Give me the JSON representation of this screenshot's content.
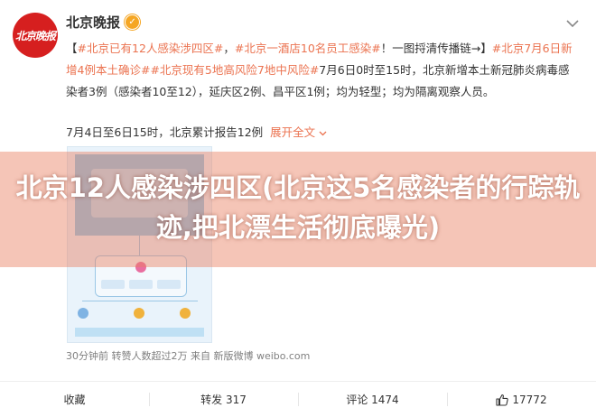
{
  "header": {
    "avatar_text": "北京晚报",
    "user_name": "北京晚报",
    "verified_icon": "verified-badge-icon"
  },
  "post": {
    "bracket_open": "【",
    "tag1": "#北京已有12人感染涉四区#",
    "sep1": "，",
    "tag2": "#北京一酒店10名员工感染#",
    "mid1": "！一图捋清传播链→】",
    "tag3": "#北京7月6日新增4例本土确诊#",
    "tag4": "#北京现有5地高风险7地中风险#",
    "body": "7月6日0时至15时，北京新增本土新冠肺炎病毒感染者3例（感染者10至12），延庆区2例、昌平区1例；均为轻型；均为隔离观察人员。",
    "sub_text": "7月4日至6日15时，北京累计报告12例",
    "expand_label": "展开全文"
  },
  "overlay": {
    "headline": "北京12人感染涉四区(北京这5名感染者的行踪轨迹,把北漂生活彻底曝光)"
  },
  "meta": {
    "text": "30分钟前 转赞人数超过2万  来自 新版微博 weibo.com"
  },
  "actions": {
    "favorite_label": "收藏",
    "repost_label": "转发 317",
    "comment_label": "评论 1474",
    "like_count": "17772"
  },
  "colors": {
    "link": "#eb7350",
    "avatar_bg": "#d61f1f",
    "verified": "#f5a623"
  }
}
